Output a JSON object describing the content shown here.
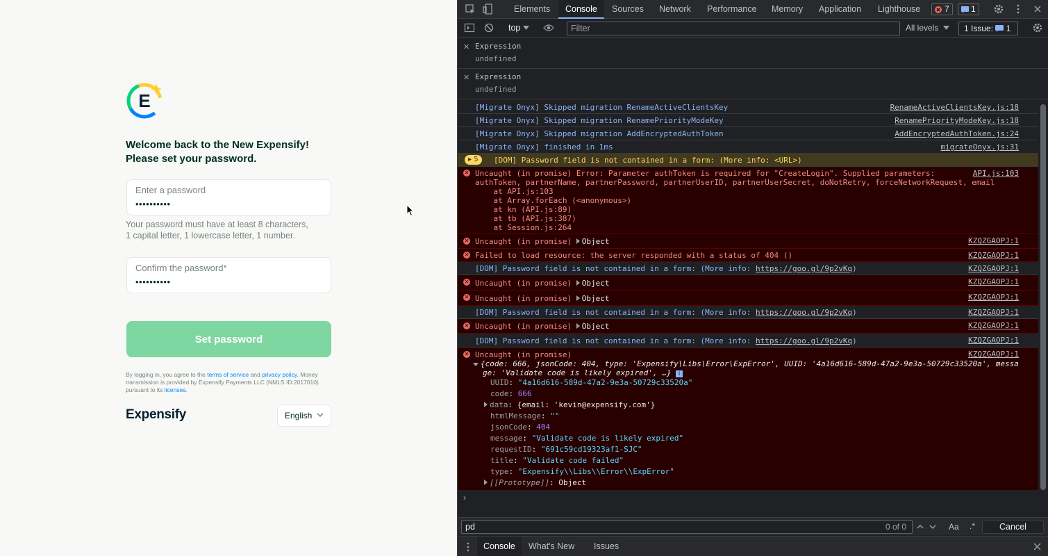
{
  "app": {
    "welcome_line1": "Welcome back to the New Expensify!",
    "welcome_line2": "Please set your password.",
    "password_label": "Enter a password",
    "password_value": "••••••••••",
    "hint_line1": "Your password must have at least 8 characters,",
    "hint_line2": "1 capital letter, 1 lowercase letter, 1 number.",
    "confirm_label": "Confirm the password*",
    "confirm_value": "••••••••••",
    "set_button": "Set password",
    "legal_1": "By logging in, you agree to the ",
    "legal_terms": "terms of service",
    "legal_and": " and ",
    "legal_privacy": "privacy policy",
    "legal_2": ". Money transmission is provided by Expensify Payments LLC (NMLS ID:2017010) pursuant to its ",
    "legal_licenses": "licenses",
    "legal_end": ".",
    "wordmark": "Expensify",
    "language": "English",
    "colors": {
      "brand_green": "#03d47c",
      "button_disabled": "#7ed6a0",
      "text_dark": "#002e22",
      "link": "#0185ff"
    }
  },
  "devtools": {
    "tabs": [
      "Elements",
      "Console",
      "Sources",
      "Network",
      "Performance",
      "Memory",
      "Application",
      "Lighthouse"
    ],
    "active_tab": "Console",
    "errors_count": "7",
    "messages_count": "1",
    "context": "top",
    "filter_placeholder": "Filter",
    "levels": "All levels",
    "issues_label": "1 Issue:",
    "issues_count": "1",
    "live_expressions": [
      {
        "label": "Expression",
        "value": "undefined"
      },
      {
        "label": "Expression",
        "value": "undefined"
      }
    ],
    "log": {
      "l1": "[Migrate Onyx] Skipped migration RenameActiveClientsKey",
      "s1": "RenameActiveClientsKey.js:18",
      "l2": "[Migrate Onyx] Skipped migration RenamePriorityModeKey",
      "s2": "RenamePriorityModeKey.js:18",
      "l3": "[Migrate Onyx] Skipped migration AddEncryptedAuthToken",
      "s3": "AddEncryptedAuthToken.js:24",
      "l4": "[Migrate Onyx] finished in 1ms",
      "s4": "migrateOnyx.js:31",
      "warn_count": "5",
      "warn": "[DOM] Password field is not contained in a form: (More info: <URL>)",
      "err1": "Uncaught (in promise) Error: Parameter authToken is required for \"CreateLogin\". Supplied parameters:",
      "err1b": "authToken, partnerName, partnerPassword, partnerUserID, partnerUserSecret, doNotRetry, forceNetworkRequest, email",
      "stack1": "    at API.js:103",
      "stack2": "    at Array.forEach (<anonymous>)",
      "stack3": "    at kn (API.js:89)",
      "stack4": "    at tb (API.js:387)",
      "stack5": "    at Session.js:264",
      "err1_src": "API.js:103",
      "uncaught": "Uncaught (in promise)",
      "object": "Object",
      "src_k": "KZQZGAOPJ:1",
      "fail": "Failed to load resource: the server responded with a status of 404 ()",
      "dom_info": "[DOM] Password field is not contained in a form: (More info: ",
      "dom_link": "https://goo.gl/9p2vKq",
      "dom_close": ")",
      "obj_summary": "{code: 666, jsonCode: 404, type: 'Expensify\\Libs\\Error\\ExpError', UUID: '4a16d616-589d-47a2-9e3a-50729c33520a', messa",
      "obj_summary2": "ge: 'Validate code is likely expired', …}",
      "props": [
        {
          "k": "UUID",
          "v": "\"4a16d616-589d-47a2-9e3a-50729c33520a\""
        },
        {
          "k": "code",
          "v": "666"
        },
        {
          "k": "data",
          "v": "{email: 'kevin@expensify.com'}"
        },
        {
          "k": "htmlMessage",
          "v": "\"\""
        },
        {
          "k": "jsonCode",
          "v": "404"
        },
        {
          "k": "message",
          "v": "\"Validate code is likely expired\""
        },
        {
          "k": "requestID",
          "v": "\"691c59cd19323af1-SJC\""
        },
        {
          "k": "title",
          "v": "\"Validate code failed\""
        },
        {
          "k": "type",
          "v": "\"Expensify\\\\Libs\\\\Error\\\\ExpError\""
        },
        {
          "k": "[[Prototype]]",
          "v": "Object"
        }
      ]
    },
    "search_value": "pd",
    "search_count": "0 of 0",
    "match_case": "Aa",
    "regex": ".*",
    "cancel": "Cancel",
    "drawer_tabs": [
      "Console",
      "What's New",
      "Issues"
    ]
  }
}
